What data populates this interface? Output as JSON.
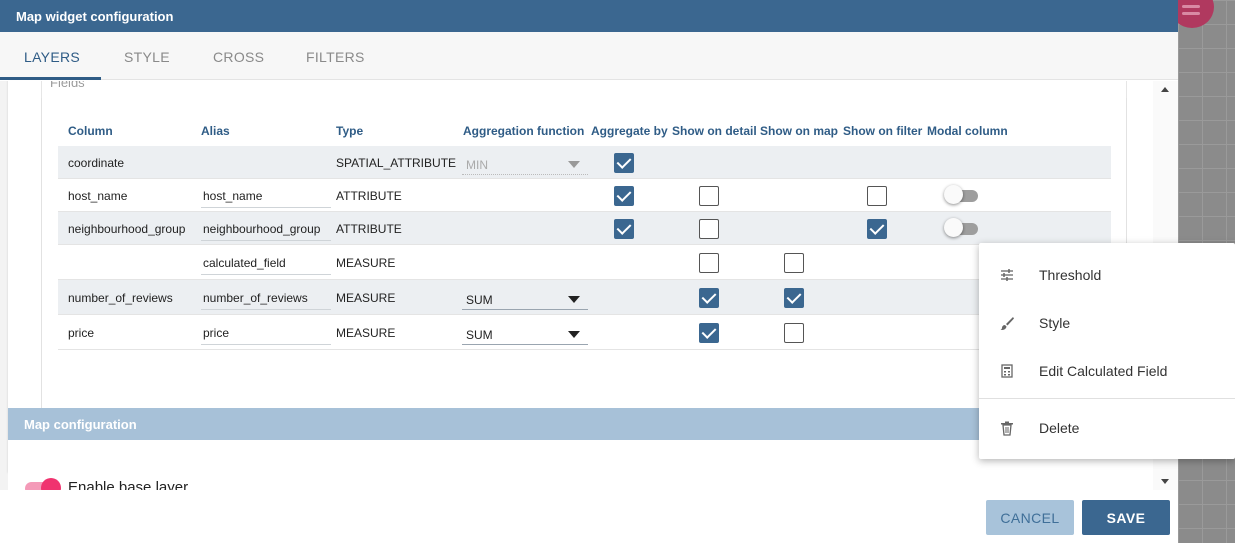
{
  "dialog": {
    "title": "Map widget configuration"
  },
  "tabs": [
    {
      "label": "LAYERS",
      "active": true
    },
    {
      "label": "STYLE",
      "active": false
    },
    {
      "label": "CROSS",
      "active": false
    },
    {
      "label": "FILTERS",
      "active": false
    }
  ],
  "fields": {
    "legend": "Fields",
    "headers": [
      "Column",
      "Alias",
      "Type",
      "Aggregation function",
      "Aggregate by",
      "Show on detail",
      "Show on map",
      "Show on filter",
      "Modal column"
    ],
    "rows": [
      {
        "column": "coordinate",
        "alias": "",
        "type": "SPATIAL_ATTRIBUTE",
        "aggregation": "MIN",
        "aggregation_disabled": true
      },
      {
        "column": "host_name",
        "alias": "host_name",
        "type": "ATTRIBUTE",
        "aggregation": ""
      },
      {
        "column": "neighbourhood_group",
        "alias": "neighbourhood_group",
        "type": "ATTRIBUTE",
        "aggregation": ""
      },
      {
        "column": "",
        "alias": "calculated_field",
        "type": "MEASURE",
        "aggregation": ""
      },
      {
        "column": "number_of_reviews",
        "alias": "number_of_reviews",
        "type": "MEASURE",
        "aggregation": "SUM"
      },
      {
        "column": "price",
        "alias": "price",
        "type": "MEASURE",
        "aggregation": "SUM"
      }
    ]
  },
  "map_config": {
    "title": "Map configuration",
    "enable_base_layer_label": "Enable base layer",
    "enable_base_layer": true
  },
  "footer": {
    "cancel_label": "CANCEL",
    "save_label": "SAVE"
  },
  "context_menu": {
    "items": [
      {
        "label": "Threshold",
        "icon": "tune-icon"
      },
      {
        "label": "Style",
        "icon": "brush-icon"
      },
      {
        "label": "Edit Calculated Field",
        "icon": "calculator-icon"
      },
      {
        "label": "Delete",
        "icon": "trash-icon"
      }
    ]
  },
  "colors": {
    "primary": "#3b6790",
    "accent_pink": "#f0336f",
    "header_light": "#a7c1d8"
  }
}
